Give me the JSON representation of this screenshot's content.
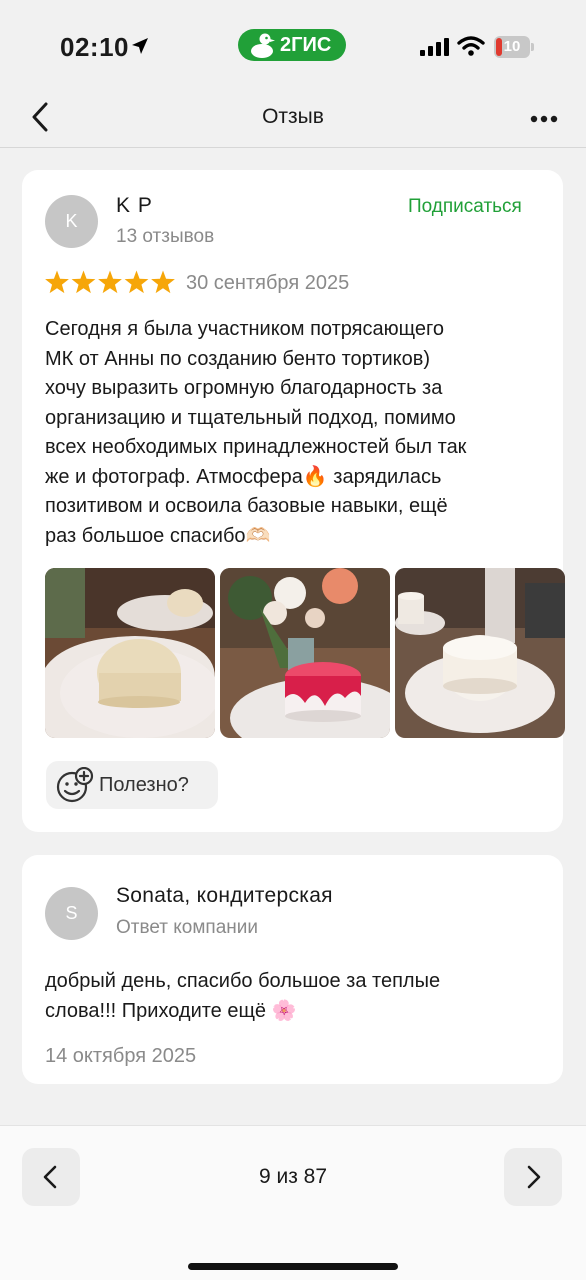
{
  "status_bar": {
    "time": "02:10",
    "brand": "2ГИС",
    "battery_level": "10"
  },
  "header": {
    "title": "Отзыв"
  },
  "review": {
    "author": {
      "initial": "K",
      "name": "K P",
      "reviews_count": "13 отзывов"
    },
    "subscribe_label": "Подписаться",
    "rating": 5,
    "date": "30 сентября 2025",
    "text": "Сегодня я была участником потрясающего\nМК от Анны по созданию бенто тортиков)\nхочу выразить огромную благодарность за\nорганизацию и тщательный подход, помимо\nвсех необходимых принадлежностей был так\nже и фотограф. Атмосфера🔥 зарядилась\nпозитивом и освоила базовые навыки, ещё\nраз большое спасибо🫶🏻",
    "helpful_label": "Полезно?"
  },
  "reply": {
    "author": {
      "initial": "S",
      "name": "Sonata, кондитерская",
      "role": "Ответ компании"
    },
    "text": "добрый день, спасибо большое за теплые\nслова!!! Приходите ещё 🌸",
    "date": "14 октября 2025"
  },
  "pager": {
    "label": "9 из 87"
  },
  "colors": {
    "accent": "#21a038",
    "star": "#f6a609",
    "background": "#f1f1f1",
    "muted_text": "#8a8a8a"
  }
}
